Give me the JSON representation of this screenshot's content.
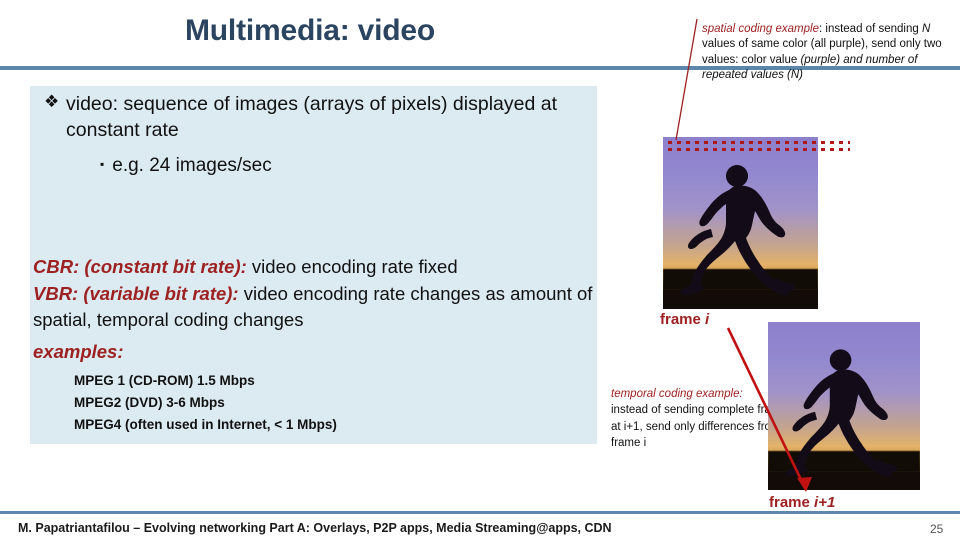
{
  "slide": {
    "title": "Multimedia: video",
    "page_number": "25",
    "footer": "M. Papatriantafilou –  Evolving networking Part A: Overlays, P2P apps, Media Streaming@apps, CDN",
    "accent_rule_color": "#5C86AB",
    "title_color": "#2B4560",
    "panel_color": "#DCEAF2",
    "highlight_color": "#9E2121"
  },
  "body": {
    "bullet1_marker": "❖",
    "bullet1_text": "video: sequence of images (arrays of pixels) displayed at constant rate",
    "bullet2_marker": "▪",
    "bullet2_text": "e.g. 24 images/sec",
    "cbr_label": "CBR: (constant bit rate):",
    "cbr_text": " video encoding rate fixed",
    "vbr_label": "VBR:  (variable bit rate):",
    "vbr_text": " video encoding rate changes as amount of spatial, temporal coding changes",
    "examples_label": "examples:",
    "mpeg_items": [
      "MPEG 1 (CD-ROM) 1.5 Mbps",
      "MPEG2 (DVD) 3-6 Mbps",
      "MPEG4 (often used in Internet, < 1 Mbps)"
    ]
  },
  "annotations": {
    "spatial_label": "spatial coding example",
    "spatial_rest_1": ": instead of sending ",
    "spatial_n1": "N",
    "spatial_rest_2": " values of same color (all purple), send only two values: color  value ",
    "spatial_purple": "(purple)",
    "spatial_and": "  and number of repeated values (N)",
    "temporal_label": "temporal coding example:",
    "temporal_text": "instead of sending complete frame at i+1, send only differences from frame i",
    "frame_i_prefix": "frame ",
    "frame_i_index": "i",
    "frame_i1_prefix": "frame ",
    "frame_i1_index": "i+1"
  }
}
